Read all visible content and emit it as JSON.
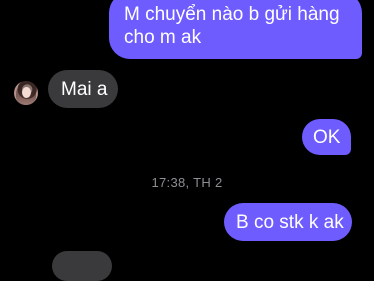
{
  "messages": [
    {
      "text": "M chuyển nào b gửi hàng\ncho m ak",
      "line1": "M chuyển nào b gửi hàng",
      "line2": "cho m ak",
      "direction": "outgoing"
    },
    {
      "text": "Mai a",
      "direction": "incoming"
    },
    {
      "text": "OK",
      "direction": "outgoing"
    },
    {
      "text": "B co stk k ak",
      "direction": "outgoing"
    }
  ],
  "timestamp": "17:38, TH 2",
  "colors": {
    "background": "#000000",
    "outgoing_bubble": "#6e5cff",
    "incoming_bubble": "#3a3a3c",
    "timestamp_text": "#8e8e93"
  },
  "icons": {
    "sender_avatar": "profile-photo"
  }
}
